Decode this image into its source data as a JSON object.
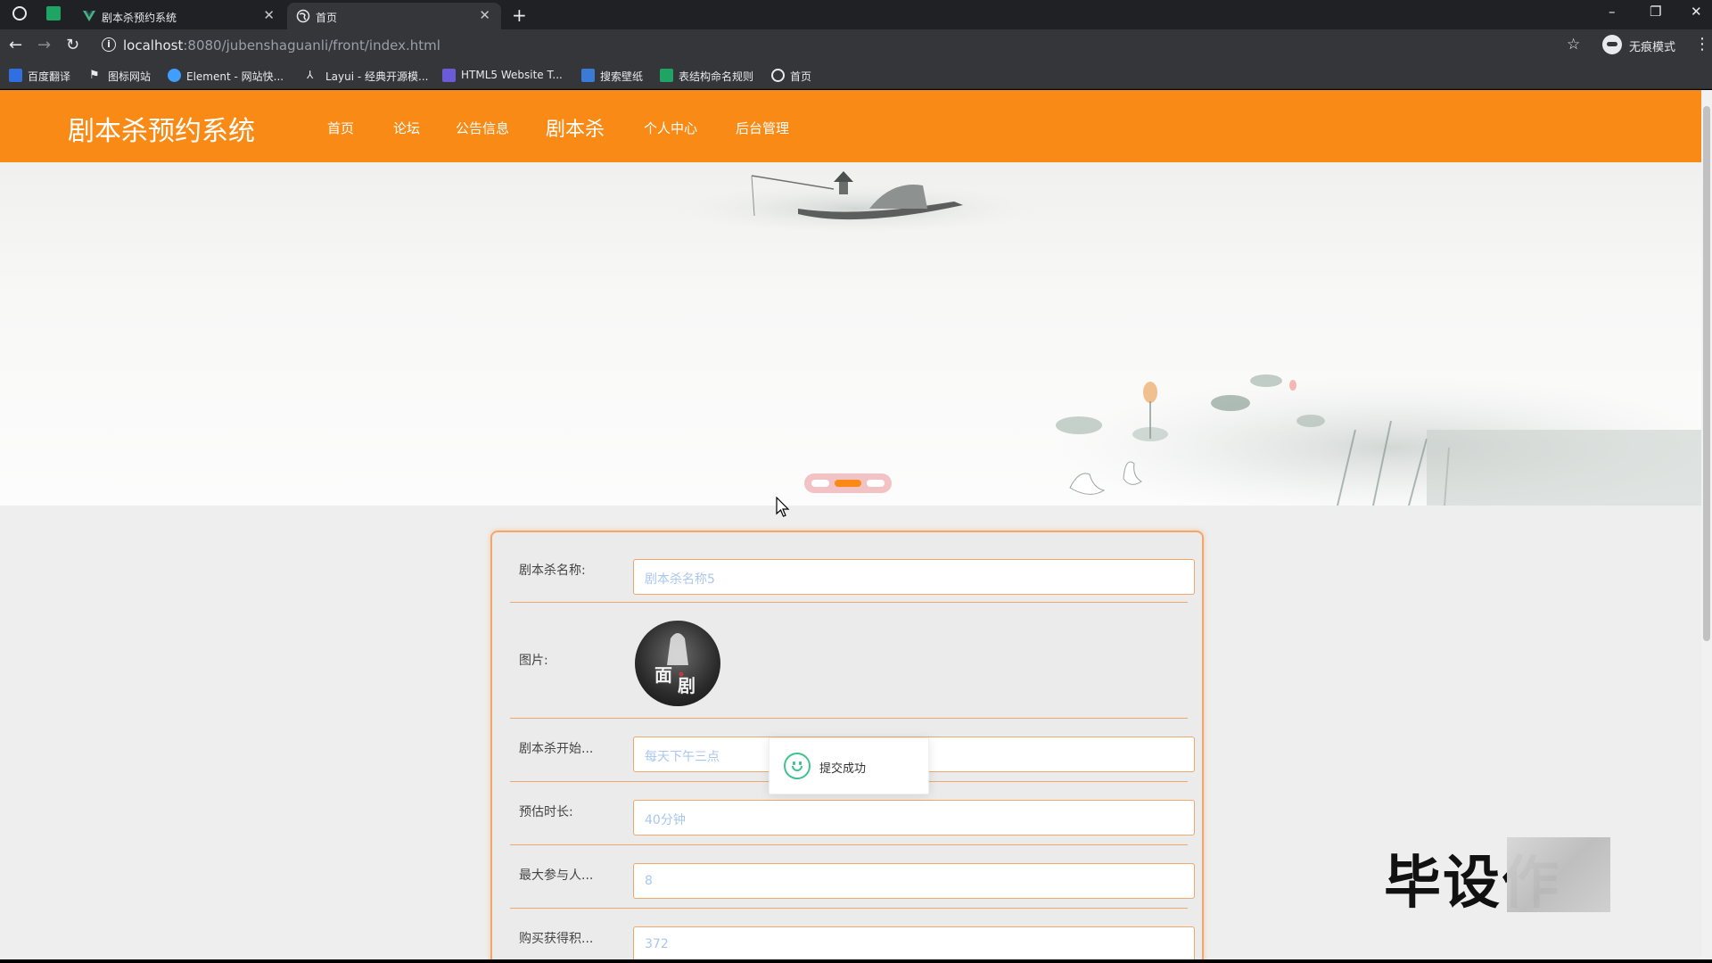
{
  "browser": {
    "tabs": [
      {
        "title": "剧本杀预约系统",
        "active": false
      },
      {
        "title": "首页",
        "active": true
      }
    ],
    "new_tab": "+",
    "window_controls": [
      "–",
      "❐",
      "✕"
    ],
    "url_host": "localhost",
    "url_rest": ":8080/jubenshaguanli/front/index.html",
    "incognito_label": "无痕模式",
    "bookmarks": [
      {
        "label": "百度翻译",
        "icon": "translate-icon",
        "color": "#2f6fe0"
      },
      {
        "label": "图标网站",
        "icon": "flag-icon",
        "color": "#e8eaed"
      },
      {
        "label": "Element - 网站快...",
        "icon": "element-icon",
        "color": "#409eff"
      },
      {
        "label": "Layui - 经典开源模...",
        "icon": "layui-icon",
        "color": "#e8eaed"
      },
      {
        "label": "HTML5 Website T...",
        "icon": "html5-icon",
        "color": "#6b5bd6"
      },
      {
        "label": "搜索壁纸",
        "icon": "wallpaper-icon",
        "color": "#3a7bd5"
      },
      {
        "label": "表结构命名规则",
        "icon": "sheet-icon",
        "color": "#1fa463"
      },
      {
        "label": "首页",
        "icon": "globe-icon",
        "color": "#e8eaed"
      }
    ]
  },
  "site": {
    "brand": "剧本杀预约系统",
    "nav": [
      "首页",
      "论坛",
      "公告信息",
      "剧本杀",
      "个人中心",
      "后台管理"
    ],
    "accent": "#f98a15"
  },
  "carousel": {
    "active_index": 1,
    "count": 3
  },
  "form": {
    "fields": [
      {
        "label": "剧本杀名称:",
        "value": "剧本杀名称5"
      },
      {
        "label": "图片:",
        "value": ""
      },
      {
        "label": "剧本杀开始...",
        "value": "每天下午三点"
      },
      {
        "label": "预估时长:",
        "value": "40分钟"
      },
      {
        "label": "最大参与人...",
        "value": "8"
      },
      {
        "label": "购买获得积...",
        "value": "372"
      }
    ]
  },
  "toast": {
    "message": "提交成功"
  },
  "watermark": {
    "text": "毕设作"
  }
}
